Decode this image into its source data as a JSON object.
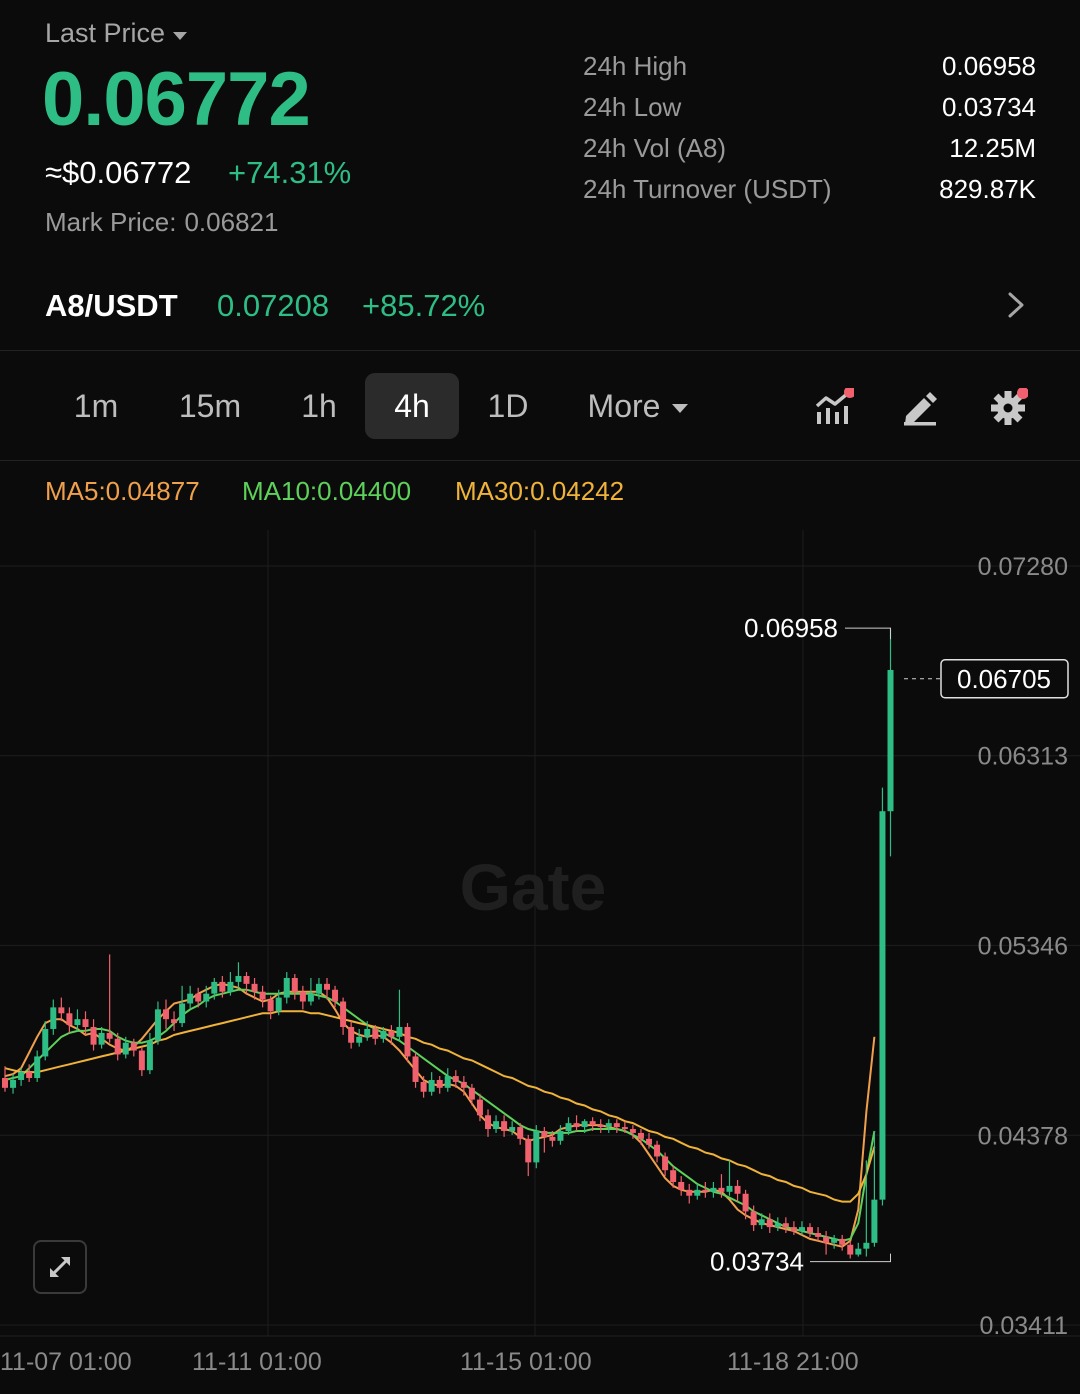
{
  "header": {
    "last_price_label": "Last Price",
    "last_price": "0.06772",
    "usd_approx": "≈$0.06772",
    "change_pct": "+74.31%",
    "mark_price_label": "Mark Price:",
    "mark_price": "0.06821"
  },
  "stats": [
    {
      "label": "24h High",
      "value": "0.06958"
    },
    {
      "label": "24h Low",
      "value": "0.03734"
    },
    {
      "label": "24h Vol (A8)",
      "value": "12.25M"
    },
    {
      "label": "24h Turnover (USDT)",
      "value": "829.87K"
    }
  ],
  "pair": {
    "name": "A8/USDT",
    "price": "0.07208",
    "change": "+85.72%"
  },
  "intervals": {
    "tabs": [
      "1m",
      "15m",
      "1h",
      "4h",
      "1D"
    ],
    "active": "4h",
    "more_label": "More"
  },
  "ma_legend": {
    "ma5": "MA5:0.04877",
    "ma10": "MA10:0.04400",
    "ma30": "MA30:0.04242"
  },
  "colors": {
    "up": "#2ebd85",
    "down": "#f0616d",
    "ma5": "#f0a04b",
    "ma10": "#5dd15a",
    "ma30": "#f0b33a",
    "badge": "#f0616d"
  },
  "chart_data": {
    "type": "candlestick",
    "watermark": "Gate",
    "y_ticks": [
      "0.07280",
      "0.06313",
      "0.05346",
      "0.04378",
      "0.03411"
    ],
    "ylim": [
      0.03411,
      0.0728
    ],
    "x_ticks": [
      "11-07 01:00",
      "11-11 01:00",
      "11-15 01:00",
      "11-18 21:00"
    ],
    "current_price": "0.06705",
    "high_label": "0.06958",
    "low_label": "0.03734",
    "high": 0.06958,
    "low": 0.03734,
    "candles": [
      [
        0.0467,
        0.0462,
        0.0473,
        0.046
      ],
      [
        0.0462,
        0.0466,
        0.0469,
        0.0459
      ],
      [
        0.0466,
        0.047,
        0.0472,
        0.0463
      ],
      [
        0.047,
        0.0467,
        0.0474,
        0.0465
      ],
      [
        0.0467,
        0.0478,
        0.0481,
        0.0465
      ],
      [
        0.0478,
        0.0492,
        0.0496,
        0.0476
      ],
      [
        0.0492,
        0.0503,
        0.0507,
        0.0489
      ],
      [
        0.0503,
        0.05,
        0.0508,
        0.0496
      ],
      [
        0.05,
        0.0494,
        0.0503,
        0.049
      ],
      [
        0.0494,
        0.0497,
        0.0502,
        0.0491
      ],
      [
        0.0497,
        0.0493,
        0.0501,
        0.0489
      ],
      [
        0.0493,
        0.0484,
        0.0497,
        0.0481
      ],
      [
        0.0484,
        0.049,
        0.0493,
        0.0482
      ],
      [
        0.049,
        0.0487,
        0.053,
        0.0485
      ],
      [
        0.0487,
        0.0479,
        0.049,
        0.0476
      ],
      [
        0.0479,
        0.0485,
        0.0488,
        0.0477
      ],
      [
        0.0485,
        0.0481,
        0.0487,
        0.0478
      ],
      [
        0.0481,
        0.0471,
        0.0483,
        0.0468
      ],
      [
        0.0471,
        0.0486,
        0.049,
        0.0469
      ],
      [
        0.0486,
        0.0502,
        0.0506,
        0.0484
      ],
      [
        0.0502,
        0.0497,
        0.0507,
        0.0492
      ],
      [
        0.0497,
        0.0495,
        0.0501,
        0.0491
      ],
      [
        0.0495,
        0.0505,
        0.0514,
        0.0493
      ],
      [
        0.0505,
        0.051,
        0.0514,
        0.0502
      ],
      [
        0.051,
        0.0506,
        0.0513,
        0.0503
      ],
      [
        0.0506,
        0.051,
        0.0514,
        0.0503
      ],
      [
        0.051,
        0.0516,
        0.0518,
        0.0507
      ],
      [
        0.0516,
        0.0511,
        0.0519,
        0.0508
      ],
      [
        0.0511,
        0.0516,
        0.0521,
        0.0509
      ],
      [
        0.0516,
        0.0519,
        0.0526,
        0.0513
      ],
      [
        0.0519,
        0.0515,
        0.0521,
        0.051
      ],
      [
        0.0515,
        0.0511,
        0.0518,
        0.0507
      ],
      [
        0.0511,
        0.0507,
        0.0514,
        0.0503
      ],
      [
        0.0507,
        0.0501,
        0.0509,
        0.0497
      ],
      [
        0.0501,
        0.0508,
        0.0512,
        0.0499
      ],
      [
        0.0508,
        0.0518,
        0.0521,
        0.0505
      ],
      [
        0.0518,
        0.0511,
        0.052,
        0.0507
      ],
      [
        0.0511,
        0.0506,
        0.0514,
        0.0502
      ],
      [
        0.0506,
        0.051,
        0.0518,
        0.0504
      ],
      [
        0.051,
        0.0515,
        0.0518,
        0.0507
      ],
      [
        0.0515,
        0.0512,
        0.0518,
        0.0507
      ],
      [
        0.0512,
        0.0506,
        0.0514,
        0.0503
      ],
      [
        0.0506,
        0.0493,
        0.0508,
        0.0489
      ],
      [
        0.0493,
        0.0485,
        0.0496,
        0.0482
      ],
      [
        0.0485,
        0.0488,
        0.0492,
        0.0483
      ],
      [
        0.0488,
        0.0492,
        0.0496,
        0.0486
      ],
      [
        0.0492,
        0.0487,
        0.0494,
        0.0484
      ],
      [
        0.0487,
        0.0491,
        0.0493,
        0.0485
      ],
      [
        0.0491,
        0.0488,
        0.0494,
        0.0484
      ],
      [
        0.0488,
        0.0493,
        0.0512,
        0.0486
      ],
      [
        0.0493,
        0.0478,
        0.0495,
        0.0475
      ],
      [
        0.0478,
        0.0465,
        0.048,
        0.0462
      ],
      [
        0.0465,
        0.046,
        0.0468,
        0.0457
      ],
      [
        0.046,
        0.0466,
        0.047,
        0.0458
      ],
      [
        0.0466,
        0.0462,
        0.0468,
        0.0459
      ],
      [
        0.0462,
        0.0468,
        0.0472,
        0.046
      ],
      [
        0.0468,
        0.0465,
        0.0471,
        0.0462
      ],
      [
        0.0465,
        0.0462,
        0.0468,
        0.0458
      ],
      [
        0.0462,
        0.0456,
        0.0464,
        0.0453
      ],
      [
        0.0456,
        0.0448,
        0.0459,
        0.0445
      ],
      [
        0.0448,
        0.0441,
        0.0451,
        0.0437
      ],
      [
        0.0441,
        0.0445,
        0.0448,
        0.0439
      ],
      [
        0.0445,
        0.044,
        0.0448,
        0.0437
      ],
      [
        0.044,
        0.0442,
        0.0445,
        0.0438
      ],
      [
        0.0442,
        0.0436,
        0.0444,
        0.0433
      ],
      [
        0.0436,
        0.0424,
        0.0438,
        0.0417
      ],
      [
        0.0424,
        0.044,
        0.0443,
        0.0421
      ],
      [
        0.044,
        0.0437,
        0.0442,
        0.0429
      ],
      [
        0.0437,
        0.0435,
        0.044,
        0.0432
      ],
      [
        0.0435,
        0.044,
        0.0443,
        0.0433
      ],
      [
        0.044,
        0.0444,
        0.0447,
        0.0438
      ],
      [
        0.0444,
        0.0442,
        0.0448,
        0.044
      ],
      [
        0.0442,
        0.0445,
        0.0446,
        0.0439
      ],
      [
        0.0445,
        0.0443,
        0.0447,
        0.044
      ],
      [
        0.0443,
        0.0442,
        0.0446,
        0.0439
      ],
      [
        0.0442,
        0.0444,
        0.0446,
        0.0439
      ],
      [
        0.0444,
        0.0442,
        0.0446,
        0.0439
      ],
      [
        0.0442,
        0.0441,
        0.0445,
        0.0439
      ],
      [
        0.0441,
        0.0439,
        0.0443,
        0.0436
      ],
      [
        0.0439,
        0.0436,
        0.0441,
        0.0433
      ],
      [
        0.0436,
        0.0433,
        0.0439,
        0.0431
      ],
      [
        0.0433,
        0.0427,
        0.0435,
        0.0424
      ],
      [
        0.0427,
        0.042,
        0.0429,
        0.0417
      ],
      [
        0.042,
        0.0414,
        0.0422,
        0.0411
      ],
      [
        0.0414,
        0.041,
        0.0417,
        0.0407
      ],
      [
        0.041,
        0.0407,
        0.0413,
        0.0403
      ],
      [
        0.0407,
        0.041,
        0.0413,
        0.0405
      ],
      [
        0.041,
        0.0409,
        0.0414,
        0.0406
      ],
      [
        0.0409,
        0.0411,
        0.0414,
        0.0406
      ],
      [
        0.0411,
        0.0409,
        0.0418,
        0.0406
      ],
      [
        0.0409,
        0.0412,
        0.0425,
        0.0407
      ],
      [
        0.0412,
        0.0408,
        0.0415,
        0.0404
      ],
      [
        0.0408,
        0.0399,
        0.041,
        0.0395
      ],
      [
        0.0399,
        0.0392,
        0.0402,
        0.0389
      ],
      [
        0.0392,
        0.0395,
        0.0398,
        0.039
      ],
      [
        0.0395,
        0.0391,
        0.0398,
        0.0388
      ],
      [
        0.0391,
        0.0393,
        0.0396,
        0.0389
      ],
      [
        0.0393,
        0.0391,
        0.0396,
        0.0388
      ],
      [
        0.0391,
        0.0389,
        0.0394,
        0.0387
      ],
      [
        0.0389,
        0.0391,
        0.0394,
        0.0387
      ],
      [
        0.0391,
        0.0388,
        0.0393,
        0.0386
      ],
      [
        0.0388,
        0.0386,
        0.0391,
        0.0384
      ],
      [
        0.0386,
        0.0383,
        0.0389,
        0.0377
      ],
      [
        0.0383,
        0.0385,
        0.0387,
        0.038
      ],
      [
        0.0385,
        0.0382,
        0.0387,
        0.0379
      ],
      [
        0.0382,
        0.0377,
        0.0384,
        0.0375
      ],
      [
        0.0377,
        0.038,
        0.0383,
        0.0376
      ],
      [
        0.038,
        0.0383,
        0.0425,
        0.0376
      ],
      [
        0.0383,
        0.0405,
        0.044,
        0.0381
      ],
      [
        0.0405,
        0.0603,
        0.0615,
        0.0402
      ],
      [
        0.0603,
        0.0675,
        0.0696,
        0.058
      ]
    ],
    "ma_series": [
      {
        "name": "MA5",
        "values": [
          0.0468,
          0.0469,
          0.0472,
          0.048,
          0.0488,
          0.0495,
          0.0497,
          0.0497,
          0.0494,
          0.0492,
          0.0489,
          0.049,
          0.0487,
          0.0484,
          0.0482,
          0.0481,
          0.0483,
          0.0487,
          0.0492,
          0.0497,
          0.0501,
          0.0505,
          0.0506,
          0.0507,
          0.051,
          0.0512,
          0.0514,
          0.0515,
          0.0514,
          0.0513,
          0.051,
          0.0508,
          0.0506,
          0.0507,
          0.051,
          0.0511,
          0.0511,
          0.0511,
          0.0511,
          0.0511,
          0.0508,
          0.0502,
          0.0495,
          0.0491,
          0.0489,
          0.0488,
          0.0489,
          0.0488,
          0.0485,
          0.0481,
          0.0476,
          0.0471,
          0.0466,
          0.0464,
          0.0463,
          0.0464,
          0.0463,
          0.046,
          0.0454,
          0.0448,
          0.0444,
          0.0442,
          0.0441,
          0.044,
          0.0437,
          0.0435,
          0.0436,
          0.0437,
          0.0438,
          0.0441,
          0.0442,
          0.0443,
          0.0443,
          0.0443,
          0.0443,
          0.0442,
          0.0441,
          0.044,
          0.0438,
          0.0434,
          0.0428,
          0.0422,
          0.0416,
          0.0412,
          0.041,
          0.0409,
          0.0409,
          0.0409,
          0.041,
          0.0409,
          0.0405,
          0.04,
          0.0397,
          0.0395,
          0.0393,
          0.0392,
          0.0391,
          0.039,
          0.0389,
          0.0387,
          0.0385,
          0.0384,
          0.0383,
          0.0382,
          0.0381,
          0.0384,
          0.04,
          0.045,
          0.0488
        ]
      },
      {
        "name": "MA10",
        "values": [
          0.0466,
          0.0467,
          0.0468,
          0.0472,
          0.0476,
          0.048,
          0.0484,
          0.0488,
          0.049,
          0.0491,
          0.0491,
          0.0492,
          0.0492,
          0.0491,
          0.0488,
          0.0486,
          0.0485,
          0.0485,
          0.0486,
          0.0488,
          0.0491,
          0.0495,
          0.0499,
          0.0502,
          0.0504,
          0.0507,
          0.0509,
          0.051,
          0.0511,
          0.0512,
          0.0512,
          0.0511,
          0.051,
          0.051,
          0.051,
          0.051,
          0.051,
          0.051,
          0.051,
          0.0509,
          0.0508,
          0.0506,
          0.0503,
          0.05,
          0.0497,
          0.0494,
          0.0492,
          0.049,
          0.0488,
          0.0486,
          0.0483,
          0.048,
          0.0477,
          0.0474,
          0.0471,
          0.0468,
          0.0466,
          0.0464,
          0.0461,
          0.0458,
          0.0455,
          0.0452,
          0.0449,
          0.0446,
          0.0443,
          0.0441,
          0.044,
          0.0439,
          0.0439,
          0.0439,
          0.0439,
          0.044,
          0.044,
          0.0441,
          0.0441,
          0.0441,
          0.0441,
          0.044,
          0.0438,
          0.0436,
          0.0433,
          0.043,
          0.0426,
          0.0422,
          0.0419,
          0.0416,
          0.0413,
          0.0411,
          0.0409,
          0.0408,
          0.0406,
          0.0404,
          0.0402,
          0.0399,
          0.0397,
          0.0395,
          0.0393,
          0.0391,
          0.039,
          0.0389,
          0.0388,
          0.0387,
          0.0386,
          0.0385,
          0.0384,
          0.0385,
          0.0393,
          0.0418,
          0.044
        ]
      },
      {
        "name": "MA30",
        "values": [
          0.0472,
          0.0471,
          0.047,
          0.047,
          0.047,
          0.0471,
          0.0472,
          0.0473,
          0.0474,
          0.0475,
          0.0476,
          0.0477,
          0.0478,
          0.0479,
          0.048,
          0.0481,
          0.0482,
          0.0483,
          0.0484,
          0.0486,
          0.0487,
          0.0489,
          0.049,
          0.0491,
          0.0492,
          0.0493,
          0.0494,
          0.0495,
          0.0496,
          0.0497,
          0.0498,
          0.0499,
          0.05,
          0.05,
          0.0501,
          0.0501,
          0.0501,
          0.0501,
          0.05,
          0.05,
          0.0499,
          0.0498,
          0.0497,
          0.0496,
          0.0495,
          0.0494,
          0.0493,
          0.0492,
          0.0491,
          0.049,
          0.0488,
          0.0487,
          0.0485,
          0.0484,
          0.0482,
          0.0481,
          0.0479,
          0.0477,
          0.0476,
          0.0474,
          0.0472,
          0.047,
          0.0468,
          0.0467,
          0.0465,
          0.0463,
          0.0462,
          0.046,
          0.0459,
          0.0457,
          0.0456,
          0.0454,
          0.0453,
          0.0451,
          0.045,
          0.0448,
          0.0447,
          0.0445,
          0.0444,
          0.0442,
          0.044,
          0.0439,
          0.0437,
          0.0436,
          0.0434,
          0.0432,
          0.0431,
          0.0429,
          0.0428,
          0.0426,
          0.0425,
          0.0423,
          0.0422,
          0.042,
          0.0418,
          0.0417,
          0.0415,
          0.0414,
          0.0412,
          0.0411,
          0.0409,
          0.0408,
          0.0407,
          0.0405,
          0.0404,
          0.0404,
          0.0408,
          0.0418,
          0.0432
        ]
      }
    ]
  }
}
